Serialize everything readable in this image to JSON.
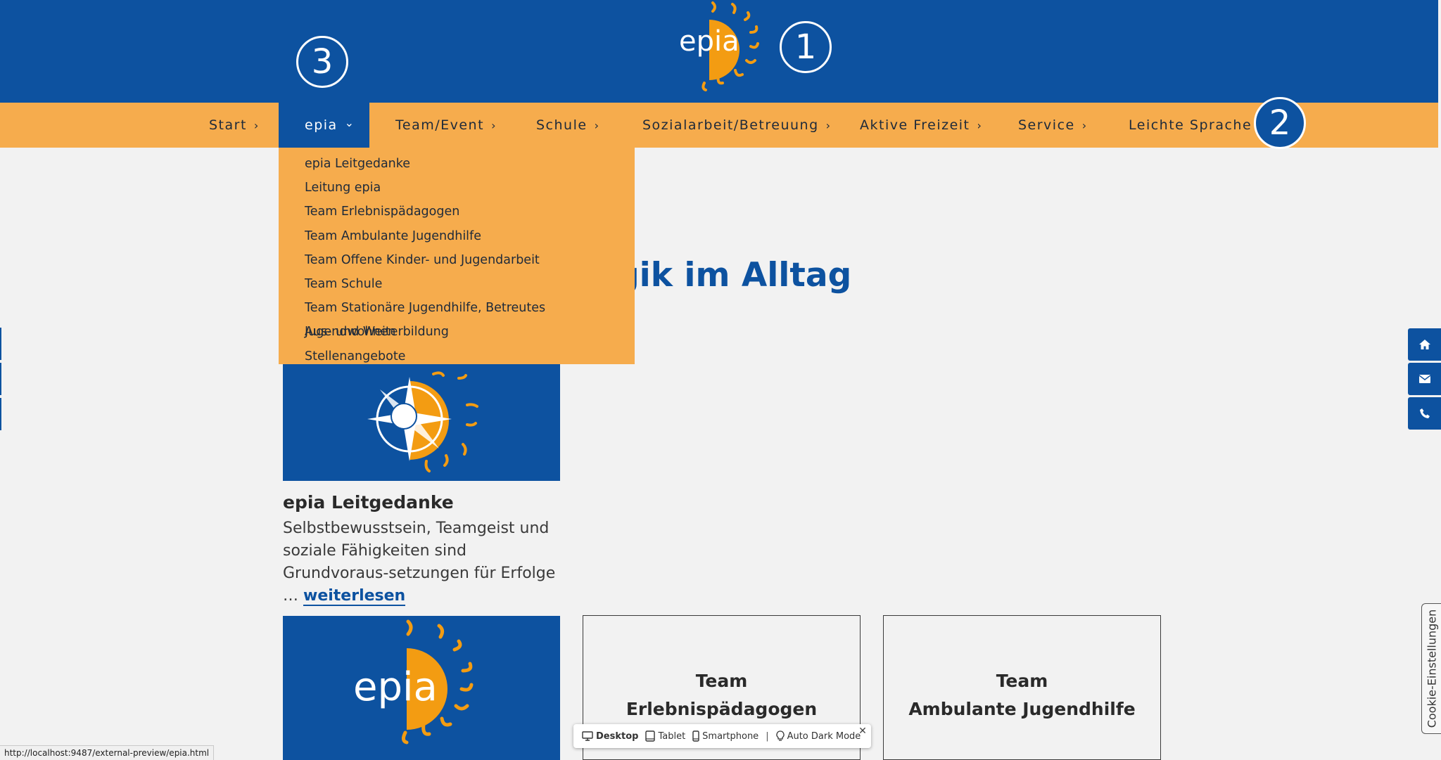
{
  "header": {
    "logo_text": "epia",
    "colors": {
      "brand_blue": "#0d52a0",
      "brand_orange": "#f6ac4d",
      "sun_orange": "#f39c12"
    }
  },
  "callouts": [
    "1",
    "2",
    "3"
  ],
  "nav": {
    "items": [
      {
        "label": "Start",
        "chevron": "›"
      },
      {
        "label": "epia",
        "chevron": "⌄"
      },
      {
        "label": "Team/Event",
        "chevron": "›"
      },
      {
        "label": "Schule",
        "chevron": "›"
      },
      {
        "label": "Sozialarbeit/Betreuung",
        "chevron": "›"
      },
      {
        "label": "Aktive Freizeit",
        "chevron": "›"
      },
      {
        "label": "Service",
        "chevron": "›"
      },
      {
        "label": "Leichte Sprache",
        "chevron": ""
      }
    ],
    "dropdown": [
      "epia Leitgedanke",
      "Leitung epia",
      "Team Erlebnispädagogen",
      "Team Ambulante Jugendhilfe",
      "Team Offene Kinder- und Jugendarbeit",
      "Team Schule",
      "Team Stationäre Jugendhilfe, Betreutes Jugendwohnen",
      "Aus- und Weiterbildung",
      "Stellenangebote"
    ]
  },
  "main": {
    "headline_visible": "gik im Alltag",
    "card1": {
      "title": "epia Leitgedanke",
      "text": "Selbstbewusstsein, Teamgeist und soziale Fähigkeiten sind Grundvoraus-setzungen für Erfolge … ",
      "link": "weiterlesen"
    },
    "box1": {
      "line1": "Team",
      "line2": "Erlebnispädagogen"
    },
    "box2": {
      "line1": "Team",
      "line2": "Ambulante Jugendhilfe"
    }
  },
  "side_buttons": [
    "home-icon",
    "envelope-icon",
    "phone-icon"
  ],
  "cookie_tab": "Cookie-Einstellungen",
  "preview_bar": {
    "desktop": "Desktop",
    "tablet": "Tablet",
    "smartphone": "Smartphone",
    "separator": "|",
    "dark_mode": "Auto Dark Mode",
    "close": "✕"
  },
  "status_url": "http://localhost:9487/external-preview/epia.html"
}
